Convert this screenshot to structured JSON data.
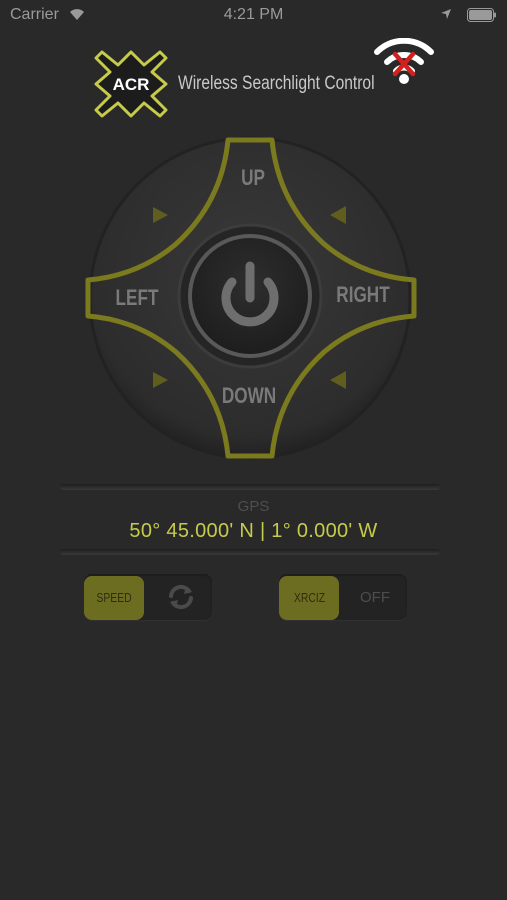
{
  "status_bar": {
    "carrier": "Carrier",
    "time": "4:21 PM",
    "icons": [
      "wifi-icon",
      "location-arrow-icon",
      "battery-icon"
    ]
  },
  "header": {
    "logo_text": "ACR",
    "title": "Wireless Searchlight Control",
    "connection_icon": "wifi-disconnected-icon"
  },
  "dpad": {
    "up": "UP",
    "down": "DOWN",
    "left": "LEFT",
    "right": "RIGHT",
    "center_icon": "power-icon"
  },
  "gps": {
    "label": "GPS",
    "coordinates": "50° 45.000' N | 1° 0.000' W"
  },
  "controls": {
    "speed_label": "SPEED",
    "speed_icon": "refresh-icon",
    "xrciz_label": "XRCIZ",
    "off_label": "OFF"
  },
  "colors": {
    "accent": "#c7cb4a",
    "accent_dark": "#6d6d22",
    "background": "#2a2929"
  }
}
